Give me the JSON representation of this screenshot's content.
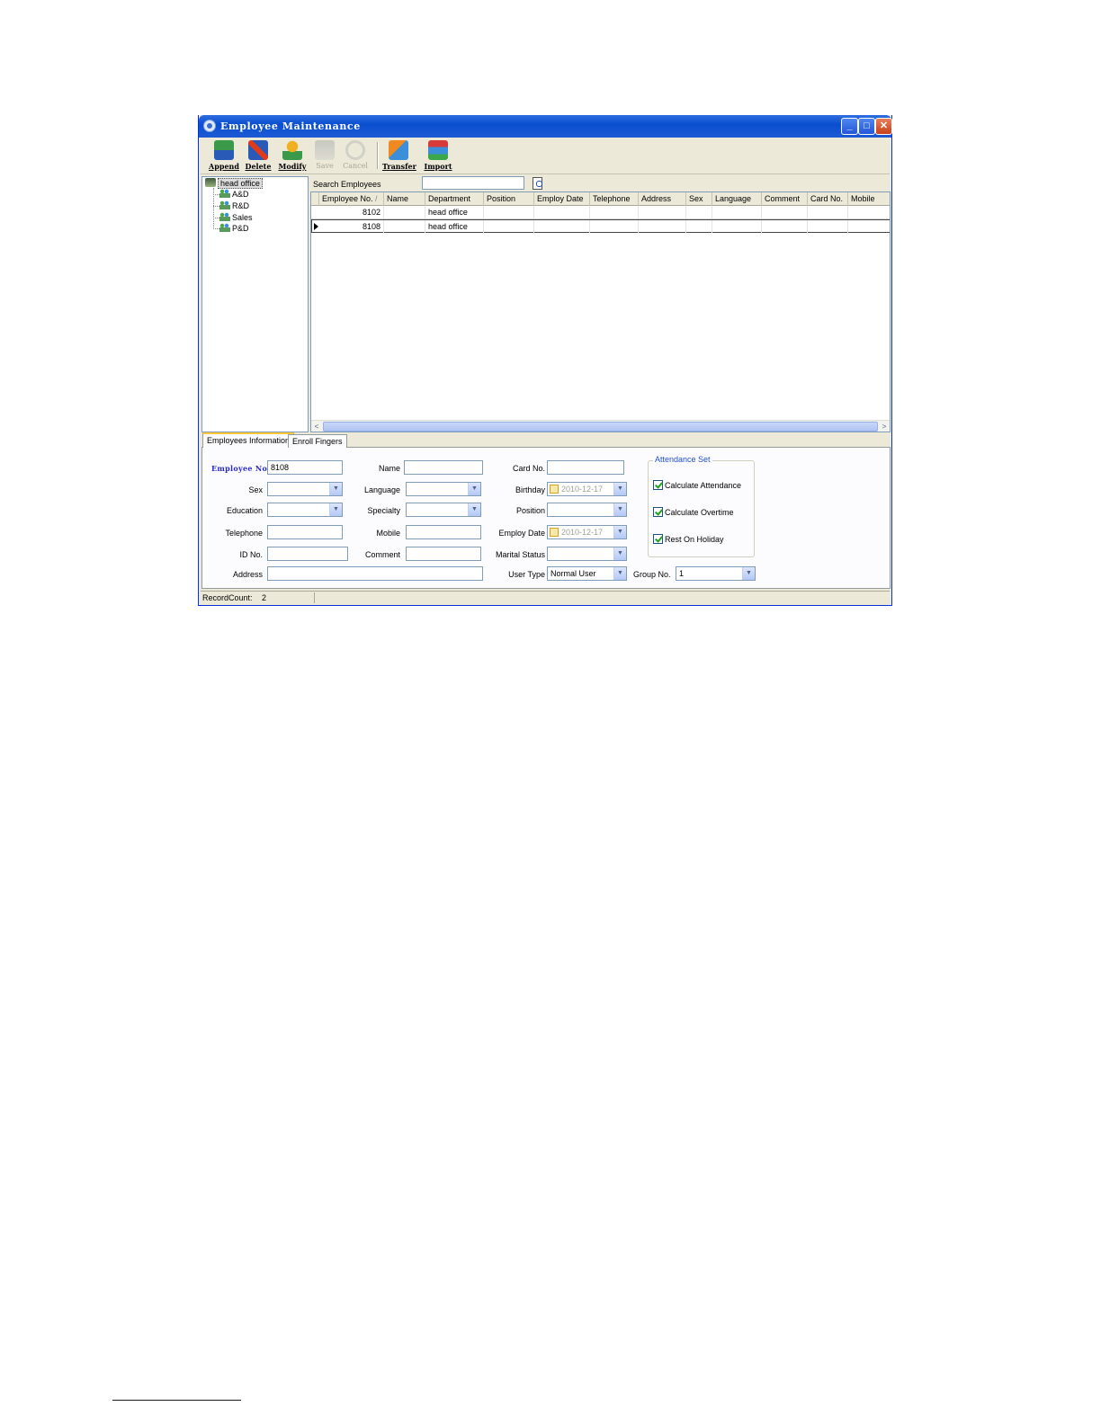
{
  "window": {
    "title": "Employee Maintenance",
    "minimize": "_",
    "maximize": "□",
    "close": "✕"
  },
  "toolbar": {
    "append": "Append",
    "delete": "Delete",
    "modify": "Modify",
    "save": "Save",
    "cancel": "Cancel",
    "transfer": "Transfer",
    "import": "Import"
  },
  "tree": {
    "root": "head office",
    "children": [
      "A&D",
      "R&D",
      "Sales",
      "P&D"
    ]
  },
  "search": {
    "label": "Search Employees",
    "value": ""
  },
  "grid": {
    "columns": [
      "Employee No.",
      "Name",
      "Department",
      "Position",
      "Employ Date",
      "Telephone",
      "Address",
      "Sex",
      "Language",
      "Comment",
      "Card No.",
      "Mobile"
    ],
    "sort_indicator": "/",
    "rows": [
      {
        "employee_no": "8102",
        "department": "head office"
      },
      {
        "employee_no": "8108",
        "department": "head office"
      }
    ],
    "scroll_left": "<",
    "scroll_right": ">"
  },
  "tabs": [
    "Employees Information",
    "Enroll Fingers"
  ],
  "form": {
    "employee_no_label": "Employee No.",
    "employee_no": "8108",
    "name_label": "Name",
    "card_no_label": "Card No.",
    "sex_label": "Sex",
    "language_label": "Language",
    "birthday_label": "Birthday",
    "birthday": "2010-12-17",
    "education_label": "Education",
    "specialty_label": "Specialty",
    "position_label": "Position",
    "telephone_label": "Telephone",
    "mobile_label": "Mobile",
    "employ_date_label": "Employ Date",
    "employ_date": "2010-12-17",
    "id_no_label": "ID No.",
    "comment_label": "Comment",
    "marital_status_label": "Marital Status",
    "address_label": "Address",
    "user_type_label": "User Type",
    "user_type": "Normal User",
    "group_no_label": "Group No.",
    "group_no": "1"
  },
  "attendance": {
    "title": "Attendance Set",
    "calculate_attendance": "Calculate Attendance",
    "calculate_overtime": "Calculate Overtime",
    "rest_on_holiday": "Rest On Holiday",
    "calculate_attendance_checked": true,
    "calculate_overtime_checked": true,
    "rest_on_holiday_checked": true
  },
  "status": {
    "record_count_label": "RecordCount:",
    "record_count": "2"
  },
  "colors": {
    "title_bar": "#0a4fd0",
    "window_face": "#ece9d8",
    "emphasis_label": "#2a2ad0",
    "group_title": "#2050d0"
  },
  "icons": {
    "append": "append-icon",
    "delete": "delete-icon",
    "modify": "modify-icon",
    "save": "save-icon",
    "cancel": "cancel-icon",
    "transfer": "transfer-icon",
    "import": "import-icon",
    "search": "search-icon"
  }
}
